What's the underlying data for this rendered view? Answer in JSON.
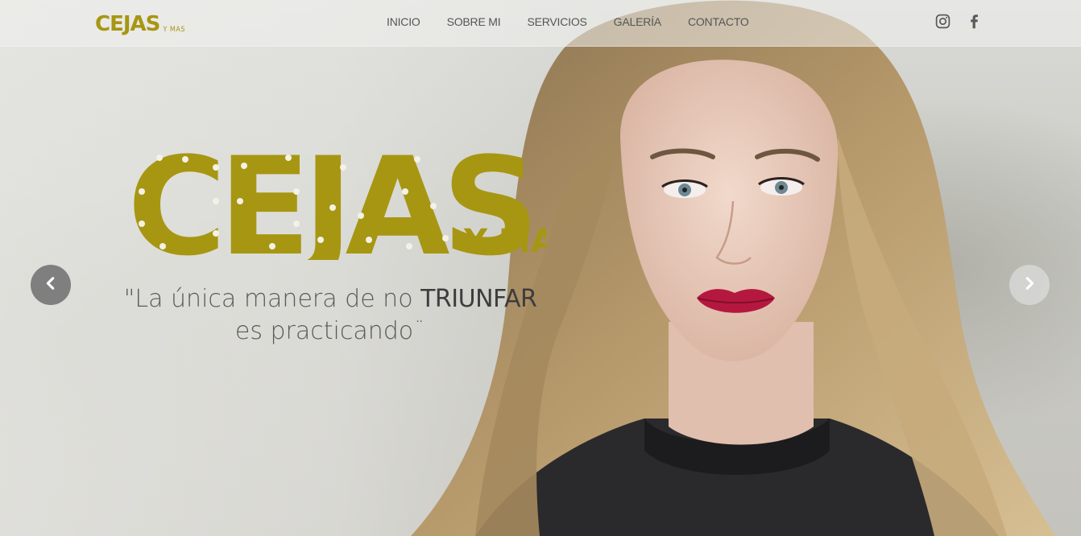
{
  "header": {
    "brand": {
      "main": "CEJAS",
      "sub": "Y MAS"
    },
    "nav": [
      {
        "label": "INICIO"
      },
      {
        "label": "SOBRE MI"
      },
      {
        "label": "SERVICIOS"
      },
      {
        "label": "GALERÍA"
      },
      {
        "label": "CONTACTO"
      }
    ],
    "social_icons": [
      "instagram-icon",
      "facebook-icon"
    ]
  },
  "hero": {
    "logo": {
      "main": "CEJAS",
      "sub": "Y MAS"
    },
    "tagline": {
      "line1_before": "\"La única manera de no ",
      "line1_emphasis": "TRIUNFAR",
      "line2": "es practicando¨"
    },
    "carousel": {
      "prev_icon": "chevron-left-icon",
      "next_icon": "chevron-right-icon"
    }
  },
  "colors": {
    "brand_gold": "#a79612",
    "nav_text": "#555555",
    "tagline_text": "#5a5a5a",
    "lips": "#b5183e"
  }
}
